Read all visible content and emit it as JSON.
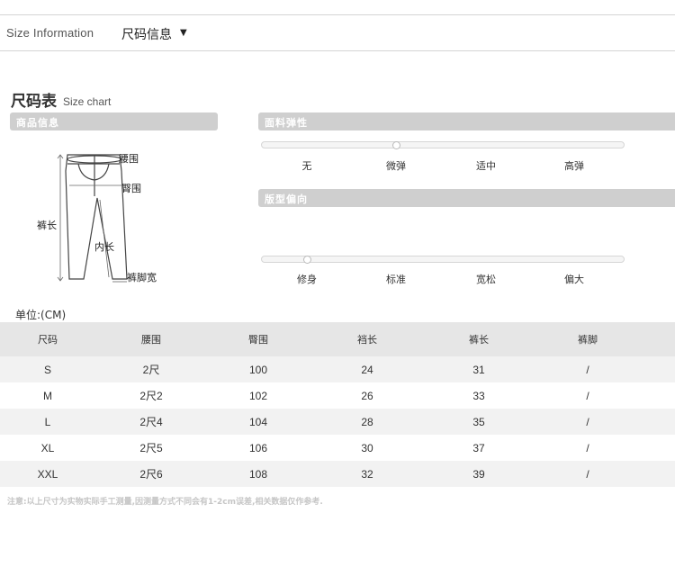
{
  "header": {
    "title_en": "Size Information",
    "title_cn": "尺码信息",
    "caret": "▼"
  },
  "size_chart": {
    "title_cn": "尺码表",
    "title_en": "Size chart"
  },
  "sections": {
    "product_info": "商品信息",
    "elasticity": "面料弹性",
    "fit": "版型偏向"
  },
  "diagram_labels": {
    "waist": "腰围",
    "hip": "臀围",
    "length": "裤长",
    "inseam": "内长",
    "leg_opening": "裤脚宽"
  },
  "elasticity": {
    "options": [
      "无",
      "微弹",
      "适中",
      "高弹"
    ],
    "selected_index": 1
  },
  "fit": {
    "options": [
      "修身",
      "标准",
      "宽松",
      "偏大"
    ],
    "selected_index": 0
  },
  "unit_label": "单位:(CM)",
  "table": {
    "headers": [
      "尺码",
      "腰围",
      "臀围",
      "裆长",
      "裤长",
      "裤脚"
    ],
    "rows": [
      [
        "S",
        "2尺",
        "100",
        "24",
        "31",
        "/"
      ],
      [
        "M",
        "2尺2",
        "102",
        "26",
        "33",
        "/"
      ],
      [
        "L",
        "2尺4",
        "104",
        "28",
        "35",
        "/"
      ],
      [
        "XL",
        "2尺5",
        "106",
        "30",
        "37",
        "/"
      ],
      [
        "XXL",
        "2尺6",
        "108",
        "32",
        "39",
        "/"
      ]
    ]
  },
  "note": "注意:以上尺寸为实物实际手工测量,因测量方式不同会有1-2cm误差,相关数据仅作参考.",
  "colors": {
    "section_bar": "#cfcfcf",
    "table_header": "#e6e6e6",
    "row_alt": "#f2f2f2"
  }
}
